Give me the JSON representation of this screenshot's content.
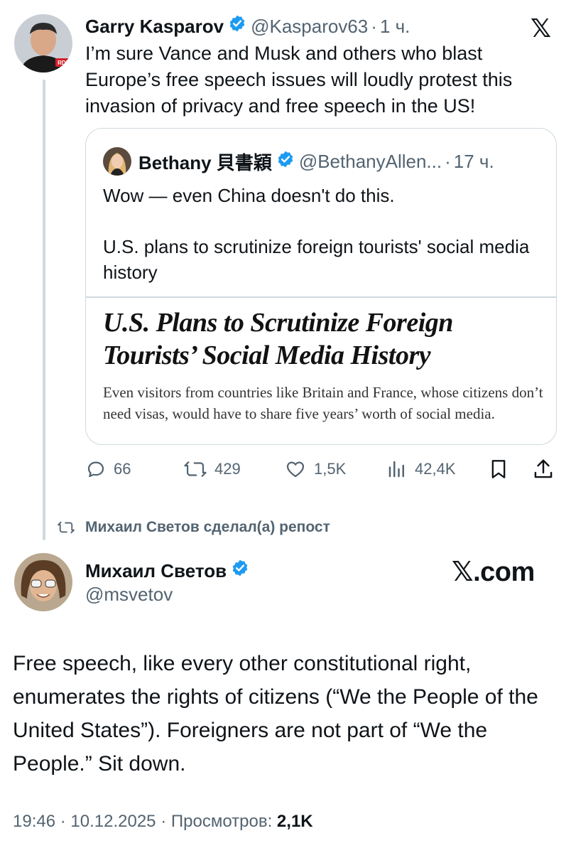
{
  "quoted_by": {
    "name": "Garry Kasparov",
    "handle": "@Kasparov63",
    "dot": "·",
    "time": "1 ч.",
    "verified": true,
    "text": "I’m sure Vance and Musk and others who blast Europe’s free speech issues will loudly protest this invasion of privacy and free speech in the US!",
    "avatar_badge": "RDI",
    "platform_logo": "𝕏",
    "quote": {
      "name": "Bethany 貝書穎",
      "handle": "@BethanyAllen...",
      "dot": "·",
      "time": "17 ч.",
      "verified": true,
      "text_line1": "Wow — even China doesn't do this.",
      "text_line2": "U.S. plans to scrutinize foreign tourists' social media history",
      "article": {
        "title": "U.S. Plans to Scrutinize Foreign Tourists’ Social Media History",
        "deck": "Even visitors from countries like Britain and France, whose citizens don’t need visas, would have to share five years’ worth of social media."
      }
    },
    "actions": {
      "replies": "66",
      "reposts": "429",
      "likes": "1,5K",
      "views": "42,4K"
    }
  },
  "repost_notice": "Михаил Светов сделал(а) репост",
  "main_tweet": {
    "name": "Михаил Светов",
    "handle": "@msvetov",
    "verified": true,
    "platform_logo": "𝕏.com",
    "text": "Free speech, like every other constitutional right, enumerates the rights of citizens (“We the People of the United States”). Foreigners are not part of “We the People.” Sit down.",
    "time": "19:46",
    "date": "10.12.2025",
    "views_label": "Просмотров:",
    "views": "2,1K",
    "separator": "·"
  },
  "colors": {
    "text": "#0f1419",
    "secondary": "#536471",
    "verified_blue": "#1d9bf0",
    "border": "#cfd9de"
  }
}
